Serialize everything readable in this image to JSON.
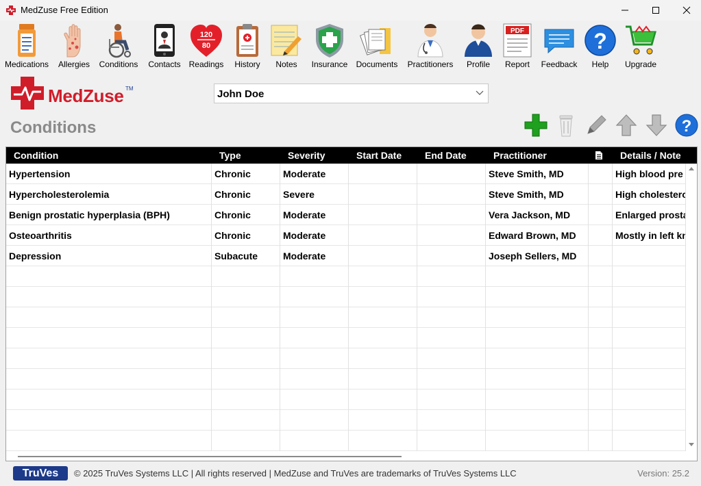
{
  "window": {
    "title": "MedZuse Free Edition"
  },
  "toolbar": [
    {
      "name": "medications",
      "label": "Medications",
      "icon": "medications-icon"
    },
    {
      "name": "allergies",
      "label": "Allergies",
      "icon": "allergies-icon"
    },
    {
      "name": "conditions",
      "label": "Conditions",
      "icon": "conditions-icon"
    },
    {
      "name": "contacts",
      "label": "Contacts",
      "icon": "contacts-icon"
    },
    {
      "name": "readings",
      "label": "Readings",
      "icon": "readings-icon",
      "top_value": "120",
      "bottom_value": "80"
    },
    {
      "name": "history",
      "label": "History",
      "icon": "history-icon"
    },
    {
      "name": "notes",
      "label": "Notes",
      "icon": "notes-icon"
    },
    {
      "name": "insurance",
      "label": "Insurance",
      "icon": "insurance-icon"
    },
    {
      "name": "documents",
      "label": "Documents",
      "icon": "documents-icon"
    },
    {
      "name": "practitioners",
      "label": "Practitioners",
      "icon": "practitioners-icon"
    },
    {
      "name": "profile",
      "label": "Profile",
      "icon": "profile-icon"
    },
    {
      "name": "report",
      "label": "Report",
      "icon": "pdf-report-icon",
      "badge": "PDF"
    },
    {
      "name": "feedback",
      "label": "Feedback",
      "icon": "feedback-icon"
    },
    {
      "name": "help",
      "label": "Help",
      "icon": "help-icon"
    },
    {
      "name": "upgrade",
      "label": "Upgrade",
      "icon": "shopping-cart-icon"
    }
  ],
  "brand": {
    "name": "MedZuse",
    "tm": "TM"
  },
  "patient": {
    "selected": "John Doe"
  },
  "page": {
    "title": "Conditions"
  },
  "table": {
    "headers": {
      "condition": "Condition",
      "type": "Type",
      "severity": "Severity",
      "start_date": "Start Date",
      "end_date": "End Date",
      "practitioner": "Practitioner",
      "details": "Details / Note"
    },
    "rows": [
      {
        "condition": "Hypertension",
        "type": "Chronic",
        "severity": "Moderate",
        "start_date": "",
        "end_date": "",
        "practitioner": "Steve Smith, MD",
        "doc": "",
        "details": "High blood pre"
      },
      {
        "condition": "Hypercholesterolemia",
        "type": "Chronic",
        "severity": "Severe",
        "start_date": "",
        "end_date": "",
        "practitioner": "Steve Smith, MD",
        "doc": "",
        "details": "High cholestero"
      },
      {
        "condition": "Benign prostatic hyperplasia (BPH)",
        "type": "Chronic",
        "severity": "Moderate",
        "start_date": "",
        "end_date": "",
        "practitioner": "Vera Jackson, MD",
        "doc": "",
        "details": "Enlarged prosta"
      },
      {
        "condition": "Osteoarthritis",
        "type": "Chronic",
        "severity": "Moderate",
        "start_date": "",
        "end_date": "",
        "practitioner": "Edward Brown, MD",
        "doc": "",
        "details": "Mostly in left kn"
      },
      {
        "condition": "Depression",
        "type": "Subacute",
        "severity": "Moderate",
        "start_date": "",
        "end_date": "",
        "practitioner": "Joseph Sellers, MD",
        "doc": "",
        "details": ""
      }
    ]
  },
  "footer": {
    "logo": "TruVes",
    "copyright": "© 2025 TruVes Systems LLC | All rights reserved | MedZuse and TruVes are trademarks of TruVes Systems LLC",
    "version": "Version: 25.2"
  },
  "colors": {
    "brand_red": "#d01d2a",
    "header_black": "#000000",
    "accent_green": "#1fa01f",
    "truves_blue": "#1d3a8a"
  }
}
